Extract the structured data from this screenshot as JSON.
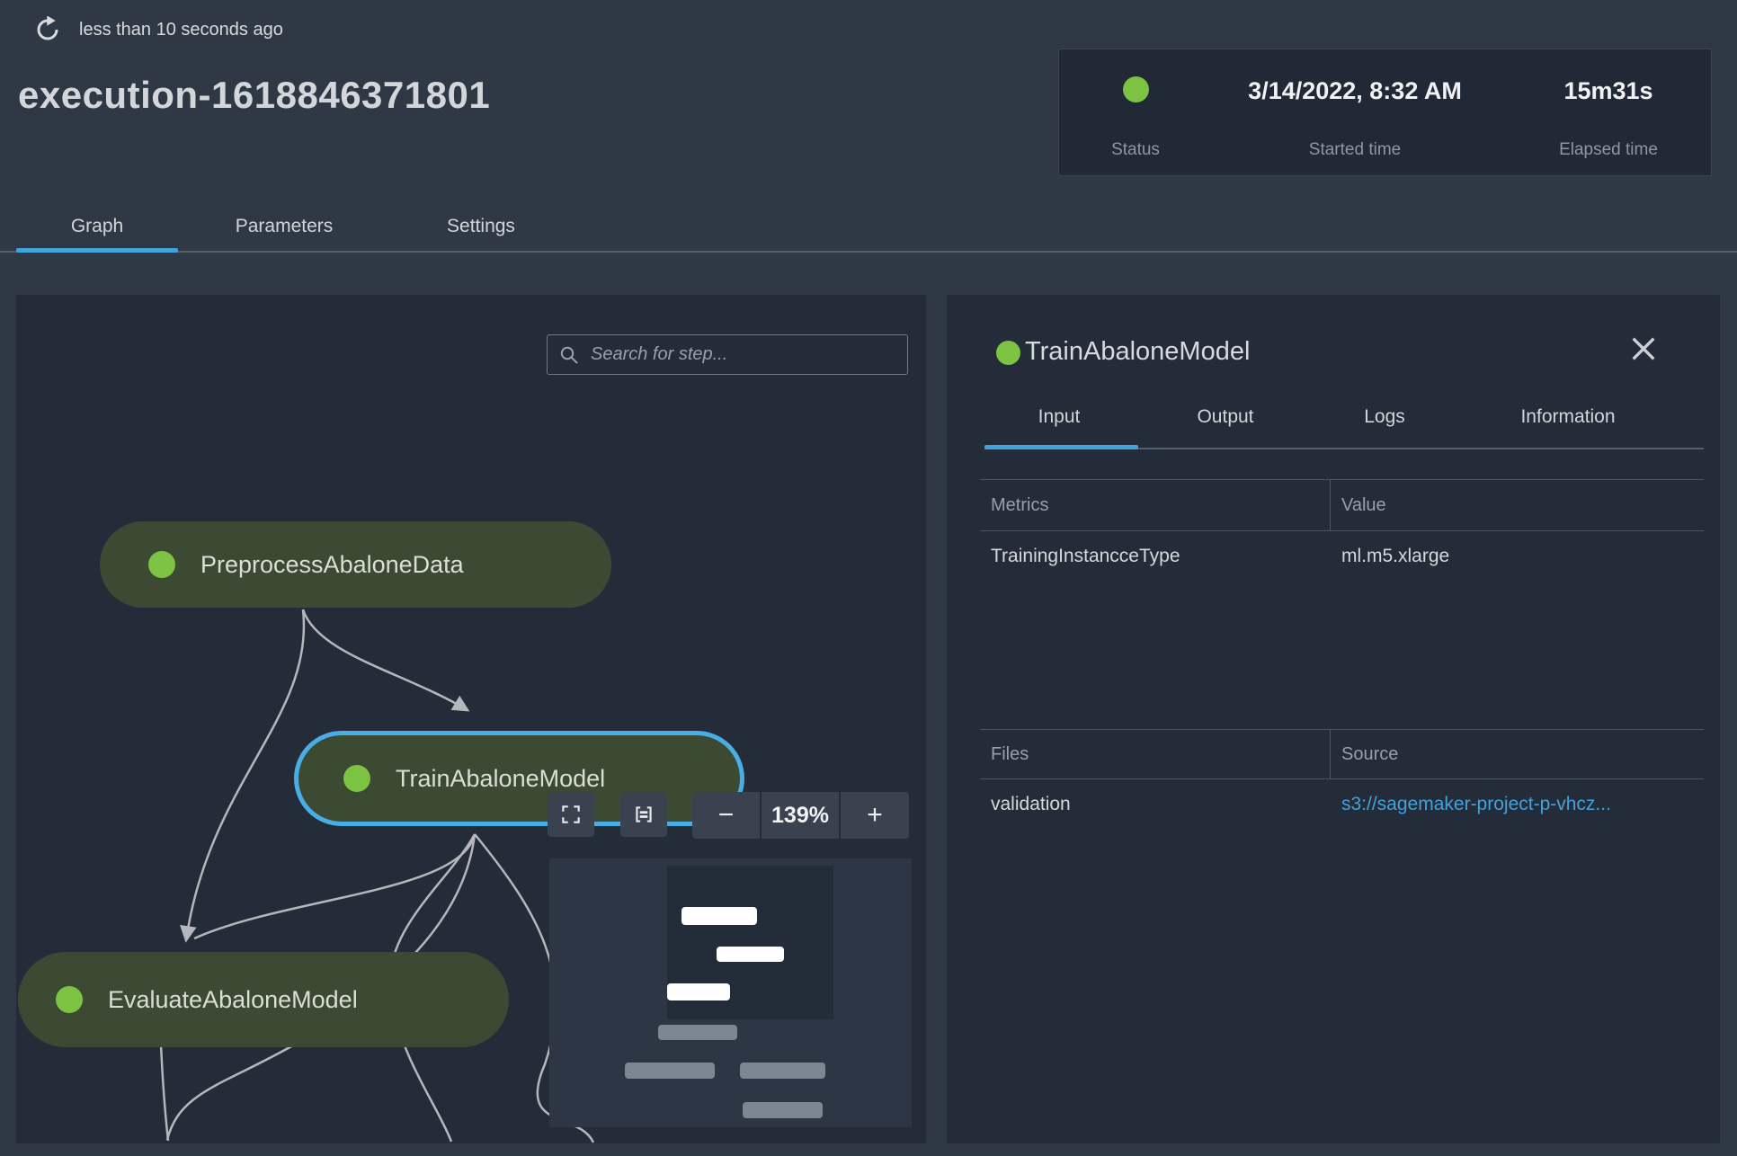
{
  "header": {
    "refreshed": "less than 10 seconds ago",
    "title": "execution-1618846371801",
    "status_panel": {
      "status_label": "Status",
      "started_label": "Started time",
      "started_value": "3/14/2022, 8:32 AM",
      "elapsed_label": "Elapsed time",
      "elapsed_value": "15m31s"
    },
    "tabs": [
      {
        "label": "Graph",
        "active": true
      },
      {
        "label": "Parameters",
        "active": false
      },
      {
        "label": "Settings",
        "active": false
      }
    ]
  },
  "graph": {
    "search_placeholder": "Search for step...",
    "zoom_out": "−",
    "zoom_level": "139%",
    "zoom_in": "+",
    "nodes": [
      {
        "label": "PreprocessAbaloneData",
        "status": "succeeded"
      },
      {
        "label": "TrainAbaloneModel",
        "status": "succeeded",
        "selected": true
      },
      {
        "label": "EvaluateAbaloneModel",
        "status": "succeeded"
      }
    ]
  },
  "details": {
    "title": "TrainAbaloneModel",
    "status": "succeeded",
    "tabs": [
      "Input",
      "Output",
      "Logs",
      "Information"
    ],
    "active_tab": "Input",
    "metrics_table": {
      "columns": [
        "Metrics",
        "Value"
      ],
      "rows": [
        [
          "TrainingInstancceType",
          "ml.m5.xlarge"
        ]
      ]
    },
    "files_table": {
      "columns": [
        "Files",
        "Source"
      ],
      "rows": [
        [
          "validation",
          "s3://sagemaker-project-p-vhcz..."
        ]
      ]
    }
  },
  "colors": {
    "status_green": "#7CC243",
    "accent_blue": "#42A4DC",
    "selected_node_border": "#4AAEE6",
    "link_blue": "#43A1DA",
    "node_fill": "#3C4A33",
    "panel_bg": "#242C39",
    "page_bg": "#2F3945"
  }
}
